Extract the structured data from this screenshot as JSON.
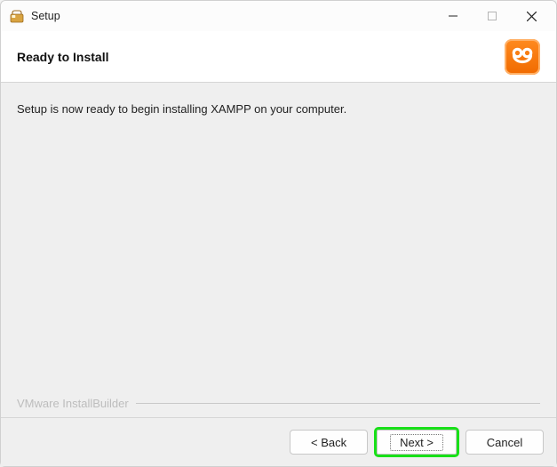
{
  "window": {
    "title": "Setup"
  },
  "header": {
    "title": "Ready to Install"
  },
  "body": {
    "message": "Setup is now ready to begin installing XAMPP on your computer."
  },
  "watermark": {
    "text": "VMware InstallBuilder"
  },
  "footer": {
    "back_label": "< Back",
    "next_label": "Next >",
    "cancel_label": "Cancel"
  },
  "icons": {
    "app": "setup-icon",
    "logo": "xampp-logo"
  },
  "colors": {
    "accent": "#f07a17",
    "highlight": "#18e018"
  }
}
